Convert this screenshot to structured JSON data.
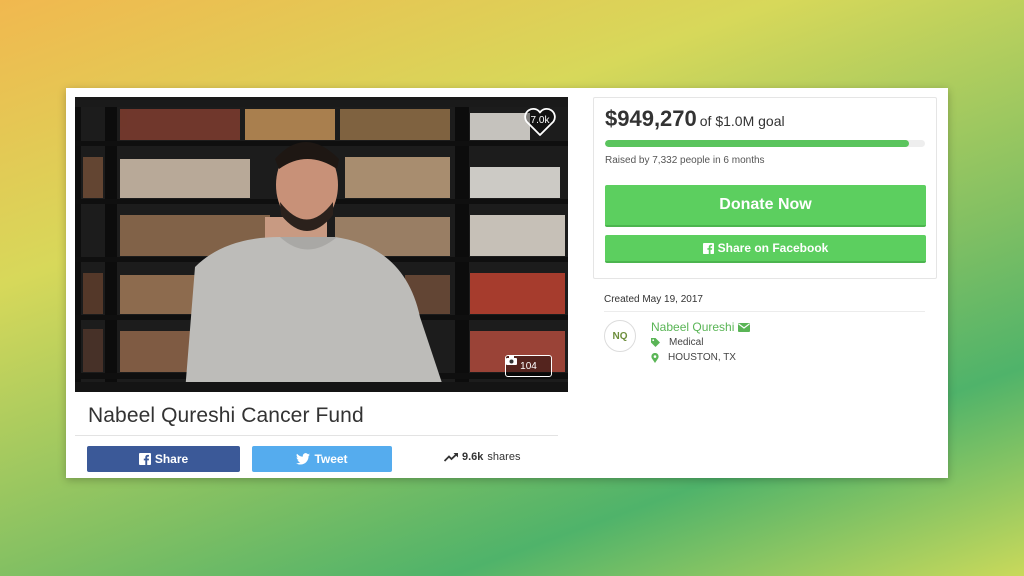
{
  "campaign": {
    "title": "Nabeel Qureshi Cancer Fund",
    "hearts": "7.0k",
    "photos": "104"
  },
  "share_bar": {
    "facebook_label": "Share",
    "tweet_label": "Tweet",
    "shares_count": "9.6k",
    "shares_suffix": "shares"
  },
  "donation": {
    "raised_amount": "$949,270",
    "goal_text": "of $1.0M goal",
    "progress_fraction": 0.949,
    "raised_by": "Raised by 7,332 people in 6 months",
    "donate_label": "Donate Now",
    "share_facebook_label": "Share on Facebook"
  },
  "meta": {
    "created": "Created May 19, 2017",
    "organizer_initials": "NQ",
    "organizer_name": "Nabeel Qureshi",
    "category": "Medical",
    "location": "HOUSTON, TX"
  },
  "icons": {
    "heart": "heart-icon",
    "camera": "camera-icon",
    "facebook": "facebook-icon",
    "twitter": "twitter-icon",
    "trend": "trending-up-icon",
    "envelope": "envelope-icon",
    "tag": "tag-icon",
    "pin": "map-pin-icon"
  },
  "colors": {
    "green": "#5ccf5f",
    "facebook": "#3b5998",
    "twitter": "#55acee"
  }
}
